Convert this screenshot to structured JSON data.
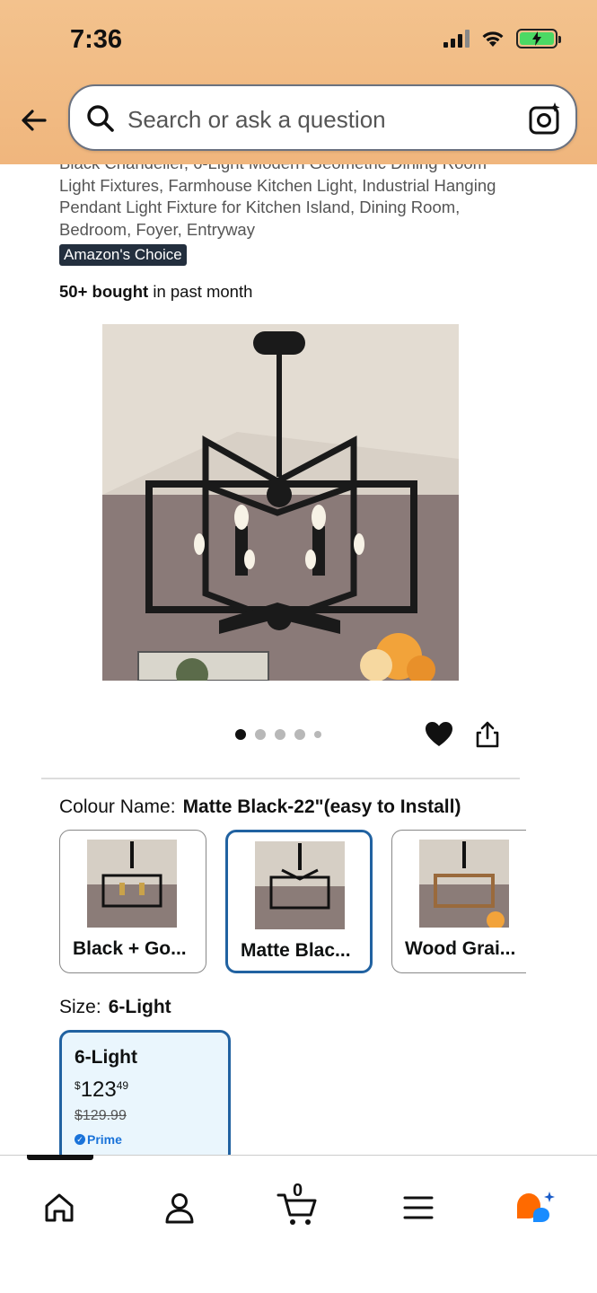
{
  "status_bar": {
    "time": "7:36"
  },
  "search": {
    "placeholder": "Search or ask a question"
  },
  "product": {
    "title_visible": "Black Chandelier, 6-Light Modern Geometric Dining Room Light Fixtures, Farmhouse Kitchen Light, Industrial Hanging Pendant Light Fixture for Kitchen Island, Dining Room, Bedroom, Foyer, Entryway",
    "badge": "Amazon's Choice",
    "bought_bold": "50+ bought",
    "bought_rest": " in past month",
    "image_count": 5,
    "active_image_index": 0
  },
  "colour": {
    "label": "Colour Name:",
    "value": "Matte Black-22\"(easy to Install)",
    "options": [
      {
        "label": "Black + Go..."
      },
      {
        "label": "Matte Blac..."
      },
      {
        "label": "Wood Grai..."
      }
    ],
    "selected_index": 1
  },
  "size": {
    "label": "Size:",
    "value": "6-Light",
    "option": {
      "name": "6-Light",
      "price_symbol": "$",
      "price_whole": "123",
      "price_fraction": "49",
      "list_price": "$129.99",
      "prime_label": "Prime"
    }
  },
  "bottom_nav": {
    "cart_count": "0",
    "items": [
      "home-icon",
      "account-icon",
      "cart-icon",
      "menu-icon",
      "rufus-icon"
    ]
  },
  "colors": {
    "header_bg": "#f0b67d",
    "selected_border": "#2162a1",
    "badge_bg": "#232f3e",
    "prime_blue": "#1a73d9",
    "rufus_orange": "#ff6a00",
    "rufus_blue": "#1a8cff"
  }
}
